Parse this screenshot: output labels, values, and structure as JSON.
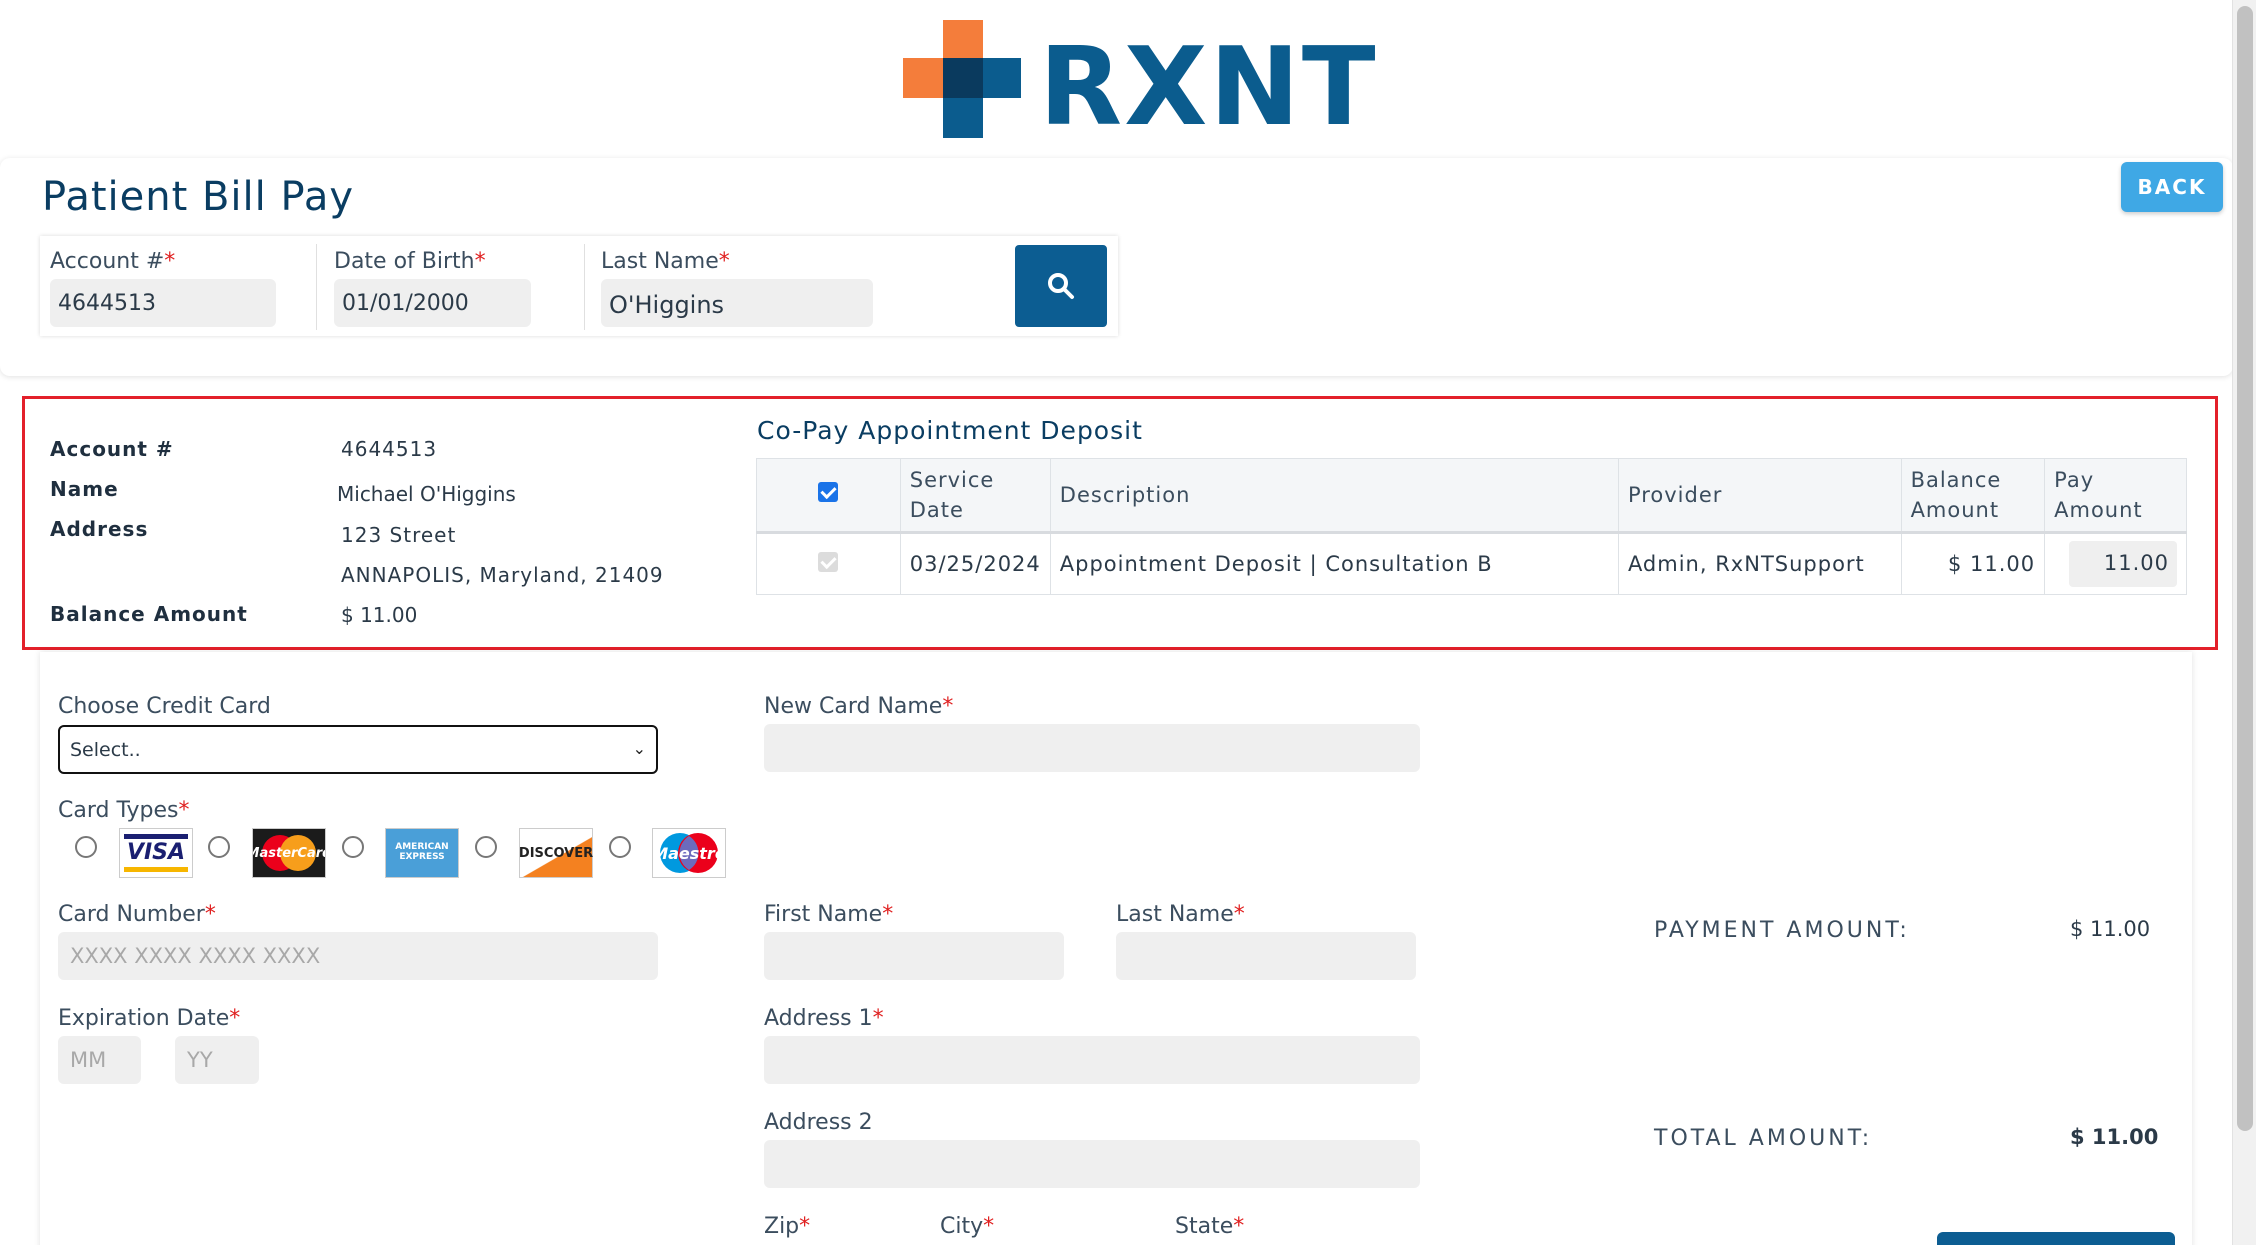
{
  "logo": {
    "text": "RXNT"
  },
  "header": {
    "title": "Patient Bill Pay",
    "back_label": "BACK"
  },
  "search": {
    "account_label": "Account #",
    "account_value": "4644513",
    "dob_label": "Date of Birth",
    "dob_value": "01/01/2000",
    "lastname_label": "Last Name",
    "lastname_value": "O'Higgins",
    "required_mark": "*"
  },
  "account": {
    "account_label": "Account #",
    "account_value": "4644513",
    "name_label": "Name",
    "name_value": "Michael O'Higgins",
    "address_label": "Address",
    "address_line1": "123 Street",
    "address_line2": "ANNAPOLIS, Maryland, 21409",
    "balance_label": "Balance Amount",
    "balance_value": "$ 11.00"
  },
  "copay": {
    "title": "Co-Pay Appointment Deposit",
    "headers": {
      "service_date_1": "Service",
      "service_date_2": "Date",
      "description": "Description",
      "provider": "Provider",
      "balance_1": "Balance",
      "balance_2": "Amount",
      "pay_amount": "Pay Amount"
    },
    "rows": [
      {
        "checked": true,
        "service_date": "03/25/2024",
        "description": "Appointment Deposit | Consultation B",
        "provider": "Admin, RxNTSupport",
        "balance": "$ 11.00",
        "pay_amount": "11.00"
      }
    ]
  },
  "payment": {
    "choose_card_label": "Choose Credit Card",
    "choose_card_value": "Select..",
    "new_card_name_label": "New Card Name",
    "card_types_label": "Card Types",
    "card_types": [
      "VISA",
      "MasterCard",
      "AMERICAN EXPRESS",
      "DISCOVER",
      "Maestro"
    ],
    "card_number_label": "Card Number",
    "card_number_placeholder": "XXXX XXXX XXXX XXXX",
    "expiration_label": "Expiration Date",
    "exp_mm_placeholder": "MM",
    "exp_yy_placeholder": "YY",
    "first_name_label": "First Name",
    "last_name_label": "Last Name",
    "address1_label": "Address 1",
    "address2_label": "Address 2",
    "zip_label": "Zip",
    "city_label": "City",
    "state_label": "State"
  },
  "summary": {
    "payment_amount_label": "PAYMENT AMOUNT:",
    "payment_amount_value": "$ 11.00",
    "total_amount_label": "TOTAL AMOUNT:",
    "total_amount_value": "$ 11.00"
  },
  "colors": {
    "brand_blue": "#0b5c8e",
    "brand_orange": "#f47d3b",
    "back_button": "#3fa8e5",
    "highlight_border": "#e3202a"
  }
}
